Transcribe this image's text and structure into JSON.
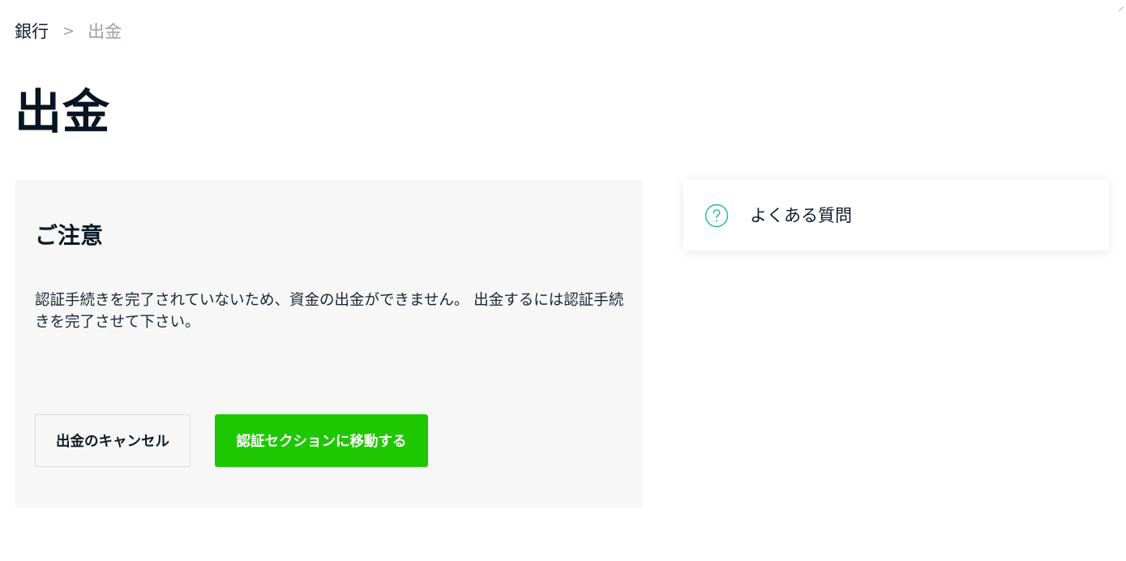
{
  "breadcrumb": {
    "parent": "銀行",
    "separator": ">",
    "current": "出金"
  },
  "page": {
    "title": "出金"
  },
  "notice": {
    "heading": "ご注意",
    "message": "認証手続きを完了されていないため、資金の出金ができません。 出金するには認証手続きを完了させて下さい。",
    "cancel_label": "出金のキャンセル",
    "verify_label": "認証セクションに移動する"
  },
  "faq": {
    "label": "よくある質問",
    "icon": "question-circle-icon"
  },
  "colors": {
    "accent_green": "#1ec800",
    "icon_teal": "#1fb89a",
    "card_bg": "#f7f7f7",
    "muted_text": "#9aa1a8"
  }
}
